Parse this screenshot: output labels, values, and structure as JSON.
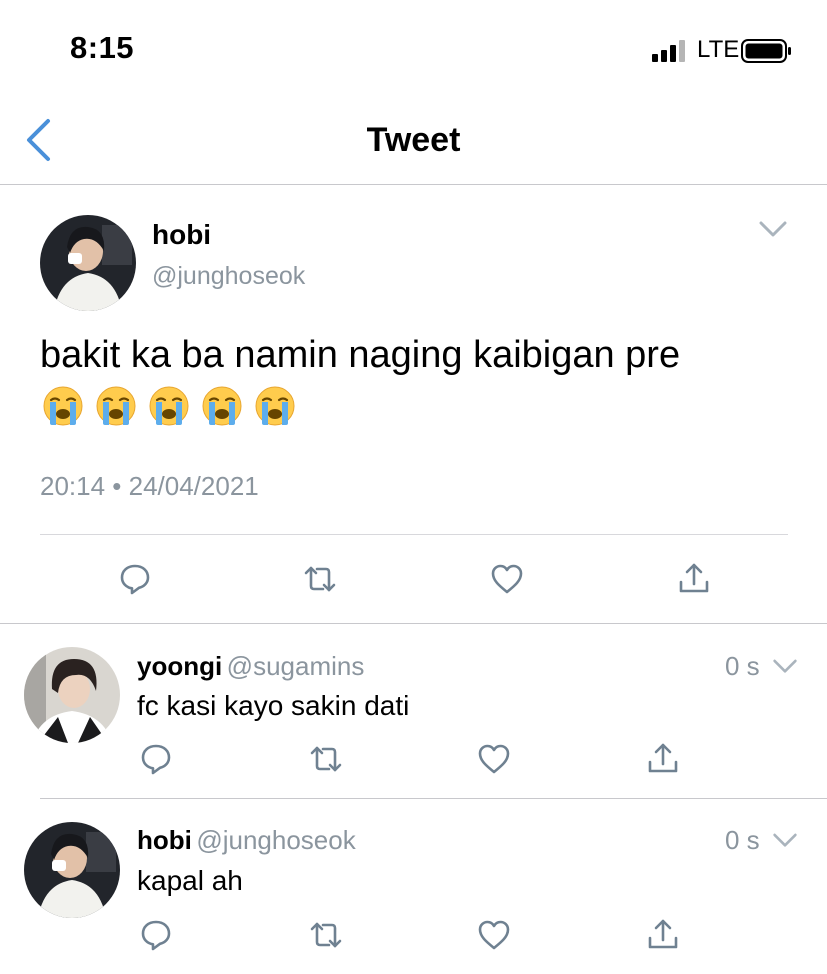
{
  "status_bar": {
    "time": "8:15",
    "network": "LTE"
  },
  "nav": {
    "title": "Tweet"
  },
  "main_tweet": {
    "author_name": "hobi",
    "author_handle": "@junghoseok",
    "text": "bakit ka ba namin naging kaibigan pre",
    "emojis": [
      "😭",
      "😭",
      "😭",
      "😭",
      "😭"
    ],
    "timestamp": "20:14 • 24/04/2021",
    "actions": [
      "reply-icon",
      "retweet-icon",
      "like-icon",
      "share-icon"
    ]
  },
  "replies": [
    {
      "name": "yoongi",
      "handle": "@sugamins",
      "time": "0 s",
      "text": "fc kasi kayo sakin dati"
    },
    {
      "name": "hobi",
      "handle": "@junghoseok",
      "time": "0 s",
      "text": "kapal ah"
    }
  ],
  "colors": {
    "accent": "#1da1f2",
    "back_arrow": "#4a90d9",
    "muted": "#8b959e",
    "icon": "#6f8191",
    "divider": "#c8c8cc"
  }
}
